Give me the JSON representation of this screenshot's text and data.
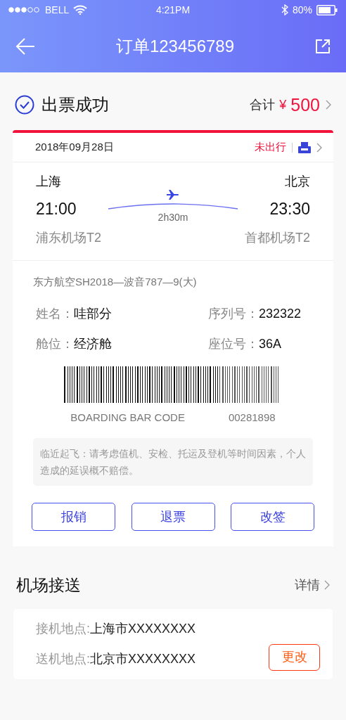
{
  "status_bar": {
    "carrier": "BELL",
    "time": "4:21PM",
    "battery": "80%"
  },
  "header": {
    "title": "订单123456789"
  },
  "summary": {
    "title": "出票成功",
    "total_label": "合计",
    "currency": "¥",
    "amount": "500"
  },
  "ticket": {
    "date": "2018年09月28日",
    "trip_status": "未出行",
    "from": {
      "city": "上海",
      "time": "21:00",
      "airport": "浦东机场T2"
    },
    "to": {
      "city": "北京",
      "time": "23:30",
      "airport": "首都机场T2"
    },
    "duration": "2h30m",
    "flight": "东方航空SH2018—波音787—9(大)",
    "fields": [
      {
        "label": "姓名：",
        "value": "哇部分"
      },
      {
        "label": "序列号：",
        "value": "232322"
      },
      {
        "label": "舱位：",
        "value": "经济舱"
      },
      {
        "label": "座位号：",
        "value": "36A"
      }
    ],
    "barcode": {
      "caption": "BOARDING BAR CODE",
      "number": "00281898"
    },
    "notice": "临近起飞：请考虑值机、安检、托运及登机等时间因素，个人造成的延误概不赔偿。",
    "actions": [
      "报销",
      "退票",
      "改签"
    ]
  },
  "transfer": {
    "title": "机场接送",
    "detail_link": "详情",
    "rows": [
      {
        "label": "接机地点:",
        "value": "上海市XXXXXXXX"
      },
      {
        "label": "送机地点:",
        "value": "北京市XXXXXXXX"
      }
    ],
    "change_button": "更改"
  }
}
